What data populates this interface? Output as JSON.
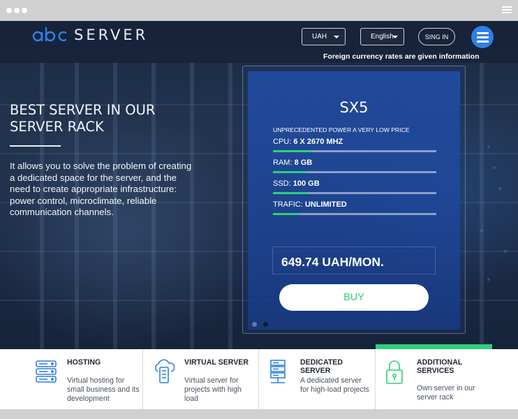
{
  "brand": {
    "logo_word": "SERVER"
  },
  "header": {
    "currency_value": "UAH",
    "language_value": "English",
    "signin_label": "SING IN",
    "fx_note": "Foreign currency rates are given information"
  },
  "hero": {
    "title": "BEST SERVER IN OUR SERVER RACK",
    "description": "It allows you to solve the problem of creating a dedicated space for the server, and the need to create appropriate infrastructure: power control, microclimate, reliable communication channels."
  },
  "plan": {
    "name": "SX5",
    "tagline": "UNPRECEDENTED POWER A VERY LOW PRICE",
    "specs": [
      {
        "key": "CPU:",
        "value": "6 X 2670 MHZ",
        "level": 0.24
      },
      {
        "key": "RAM:",
        "value": "8 GB",
        "level": 0.2
      },
      {
        "key": "SSD:",
        "value": "100 GB",
        "level": 0.22
      },
      {
        "key": "TRAFIC:",
        "value": "UNLIMITED",
        "level": 0.16
      }
    ],
    "price": "649.74 UAH/MON.",
    "buy_label": "BUY",
    "slides_total": 2,
    "slide_active": 2
  },
  "features": [
    {
      "title": "HOSTING",
      "desc": "Virtual hosting for small business and its development",
      "icon": "server-stack-icon"
    },
    {
      "title": "VIRTUAL SERVER",
      "desc": "Virtual server for projects with high load",
      "icon": "cloud-server-icon"
    },
    {
      "title": "DEDICATED SERVER",
      "desc": "A dedicated server for high-load projects",
      "icon": "server-tower-icon"
    },
    {
      "title": "ADDITIONAL SERVICES",
      "desc": "Own server in our server rack",
      "icon": "lock-icon"
    }
  ],
  "colors": {
    "accent_blue": "#2f7fe6",
    "accent_green": "#2ecf7c",
    "icon_blue": "#2f7fe6",
    "icon_green": "#2ecf7c"
  }
}
